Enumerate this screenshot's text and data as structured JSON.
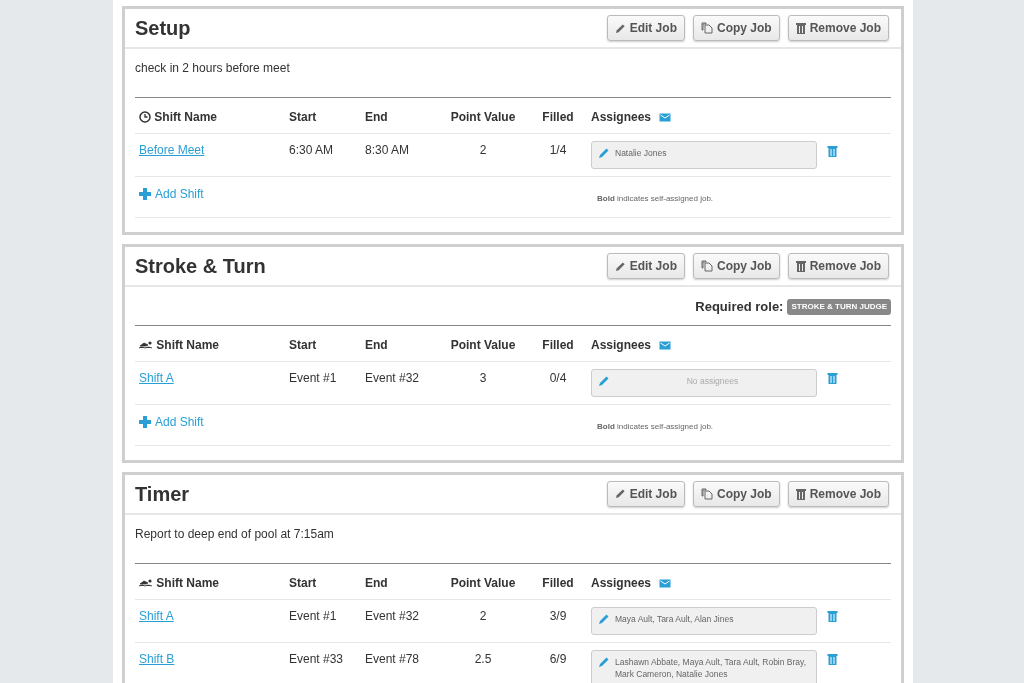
{
  "jobs": [
    {
      "title": "Setup",
      "buttons": [
        {
          "kind": "edit",
          "label": "Edit Job"
        },
        {
          "kind": "copy",
          "label": "Copy Job"
        },
        {
          "kind": "remove",
          "label": "Remove Job"
        }
      ],
      "description": "check in 2 hours before meet",
      "columns": [
        {
          "label": "Shift Name",
          "kind": "clock"
        },
        {
          "label": "Start",
          "kind": "text"
        },
        {
          "label": "End",
          "kind": "text"
        },
        {
          "label": "Point Value",
          "kind": "text"
        },
        {
          "label": "Filled",
          "kind": "text"
        },
        {
          "label": "Assignees",
          "kind": "mail"
        }
      ],
      "shifts": [
        {
          "name": "Before Meet",
          "start": "6:30 AM",
          "end": "8:30 AM",
          "points": "2",
          "filled": "1/4",
          "assignees": "Natalie Jones",
          "empty": false
        }
      ],
      "add_shift": "Add Shift",
      "note": "**Bold** indicates self-assigned job."
    },
    {
      "title": "Stroke & Turn",
      "buttons": [
        {
          "kind": "edit",
          "label": "Edit Job"
        },
        {
          "kind": "copy",
          "label": "Copy Job"
        },
        {
          "kind": "remove",
          "label": "Remove Job"
        }
      ],
      "required_role_label": "Required role:",
      "required_role": "STROKE & TURN JUDGE",
      "columns": [
        {
          "label": "Shift Name",
          "kind": "swimmer"
        },
        {
          "label": "Start",
          "kind": "text"
        },
        {
          "label": "End",
          "kind": "text"
        },
        {
          "label": "Point Value",
          "kind": "text"
        },
        {
          "label": "Filled",
          "kind": "text"
        },
        {
          "label": "Assignees",
          "kind": "mail"
        }
      ],
      "shifts": [
        {
          "name": "Shift A",
          "start": "Event #1",
          "end": "Event #32",
          "points": "3",
          "filled": "0/4",
          "assignees": "No assignees",
          "empty": true
        }
      ],
      "add_shift": "Add Shift",
      "note": "**Bold** indicates self-assigned job."
    },
    {
      "title": "Timer",
      "buttons": [
        {
          "kind": "edit",
          "label": "Edit Job"
        },
        {
          "kind": "copy",
          "label": "Copy Job"
        },
        {
          "kind": "remove",
          "label": "Remove Job"
        }
      ],
      "description": "Report to deep end of pool at 7:15am",
      "columns": [
        {
          "label": "Shift Name",
          "kind": "swimmer"
        },
        {
          "label": "Start",
          "kind": "text"
        },
        {
          "label": "End",
          "kind": "text"
        },
        {
          "label": "Point Value",
          "kind": "text"
        },
        {
          "label": "Filled",
          "kind": "text"
        },
        {
          "label": "Assignees",
          "kind": "mail"
        }
      ],
      "shifts": [
        {
          "name": "Shift A",
          "start": "Event #1",
          "end": "Event #32",
          "points": "2",
          "filled": "3/9",
          "assignees": "Maya Ault, Tara Ault, Alan Jines",
          "empty": false
        },
        {
          "name": "Shift B",
          "start": "Event #33",
          "end": "Event #78",
          "points": "2.5",
          "filled": "6/9",
          "assignees": "Lashawn Abbate, Maya Ault, Tara Ault, Robin Bray, Mark Cameron, Natalie Jones",
          "empty": false
        }
      ]
    }
  ]
}
